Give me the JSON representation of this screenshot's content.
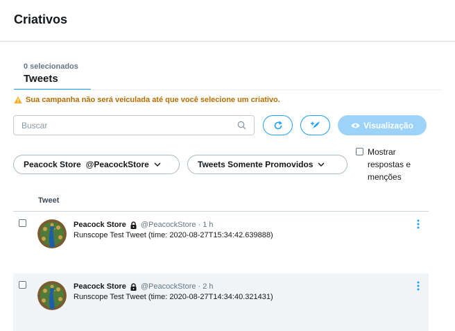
{
  "header": {
    "title": "Criativos"
  },
  "tab": {
    "count": "0 selecionados",
    "label": "Tweets"
  },
  "warning": {
    "text": "Sua campanha não será veiculada até que você selecione um criativo."
  },
  "search": {
    "placeholder": "Buscar"
  },
  "toolbar": {
    "preview_label": "Visualização"
  },
  "filters": {
    "account_name": "Peacock Store",
    "account_handle": "@PeacockStore",
    "type_label": "Tweets Somente Promovidos",
    "show_replies": "Mostrar respostas e menções"
  },
  "table": {
    "column": "Tweet"
  },
  "tweets": [
    {
      "name": "Peacock Store",
      "meta": "@PeacockStore · 1 h",
      "text": "Runscope Test Tweet (time: 2020-08-27T15:34:42.639888)"
    },
    {
      "name": "Peacock Store",
      "meta": "@PeacockStore · 2 h",
      "text": "Runscope Test Tweet (time: 2020-08-27T14:34:40.321431)"
    }
  ],
  "colors": {
    "accent": "#1da1f2",
    "accent_disabled": "#9dd3f8",
    "warning": "#b56c00",
    "row_alt": "#f0f4f7"
  },
  "icons": [
    "warning-icon",
    "search-icon",
    "refresh-icon",
    "compose-icon",
    "eye-icon",
    "chevron-down-icon",
    "lock-icon",
    "more-vertical-icon"
  ]
}
